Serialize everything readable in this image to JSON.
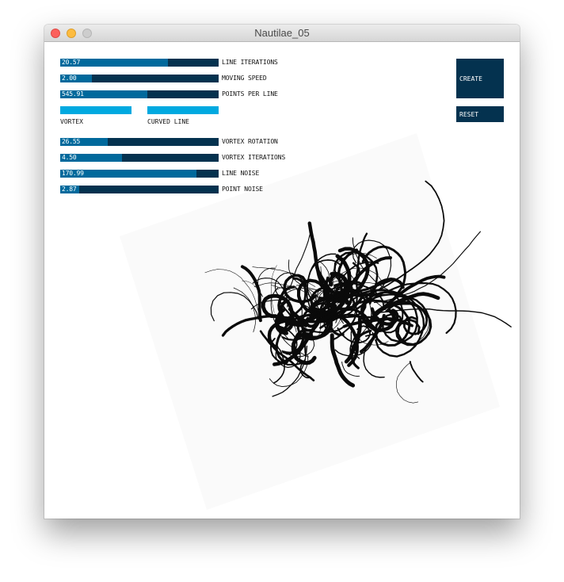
{
  "window": {
    "title": "Nautilae_05"
  },
  "sliders": [
    {
      "value": "20.57",
      "label": "LINE ITERATIONS",
      "fraction": 0.68
    },
    {
      "value": "2.00",
      "label": "MOVING SPEED",
      "fraction": 0.2
    },
    {
      "value": "545.91",
      "label": "POINTS PER LINE",
      "fraction": 0.55
    },
    {
      "value": "26.55",
      "label": "VORTEX ROTATION",
      "fraction": 0.3
    },
    {
      "value": "4.50",
      "label": "VORTEX ITERATIONS",
      "fraction": 0.39
    },
    {
      "value": "170.99",
      "label": "LINE NOISE",
      "fraction": 0.86
    },
    {
      "value": "2.87",
      "label": "POINT NOISE",
      "fraction": 0.12
    }
  ],
  "toggles": [
    {
      "label": "VORTEX"
    },
    {
      "label": "CURVED LINE"
    }
  ],
  "buttons": {
    "create": "CREATE",
    "reset": "RESET"
  },
  "colors": {
    "track": "#04324f",
    "fill": "#00699c",
    "toggle": "#00a9e0",
    "button": "#04324f",
    "art": "#0a0a0a"
  }
}
